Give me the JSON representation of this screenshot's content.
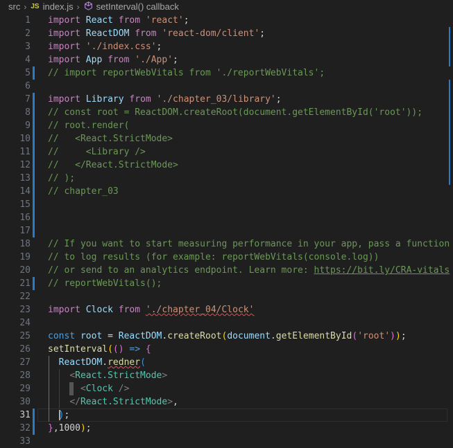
{
  "breadcrumb": {
    "folder": "src",
    "file_badge": "JS",
    "file": "index.js",
    "symbol": "setInterval() callback"
  },
  "editor": {
    "active_line": 31,
    "lines": [
      {
        "n": "1",
        "tokens": [
          [
            "kw",
            "import"
          ],
          [
            "pl",
            " "
          ],
          [
            "id",
            "React"
          ],
          [
            "pl",
            " "
          ],
          [
            "kw",
            "from"
          ],
          [
            "pl",
            " "
          ],
          [
            "st",
            "'react'"
          ],
          [
            "pl",
            ";"
          ]
        ]
      },
      {
        "n": "2",
        "tokens": [
          [
            "kw",
            "import"
          ],
          [
            "pl",
            " "
          ],
          [
            "id",
            "ReactDOM"
          ],
          [
            "pl",
            " "
          ],
          [
            "kw",
            "from"
          ],
          [
            "pl",
            " "
          ],
          [
            "st",
            "'react-dom/client'"
          ],
          [
            "pl",
            ";"
          ]
        ]
      },
      {
        "n": "3",
        "tokens": [
          [
            "kw",
            "import"
          ],
          [
            "pl",
            " "
          ],
          [
            "st",
            "'./index.css'"
          ],
          [
            "pl",
            ";"
          ]
        ]
      },
      {
        "n": "4",
        "tokens": [
          [
            "kw",
            "import"
          ],
          [
            "pl",
            " "
          ],
          [
            "id",
            "App"
          ],
          [
            "pl",
            " "
          ],
          [
            "kw",
            "from"
          ],
          [
            "pl",
            " "
          ],
          [
            "st",
            "'./App'"
          ],
          [
            "pl",
            ";"
          ]
        ]
      },
      {
        "n": "5",
        "tokens": [
          [
            "cm",
            "// import reportWebVitals from './reportWebVitals';"
          ]
        ]
      },
      {
        "n": "6",
        "tokens": []
      },
      {
        "n": "7",
        "tokens": [
          [
            "kw",
            "import"
          ],
          [
            "pl",
            " "
          ],
          [
            "id",
            "Library"
          ],
          [
            "pl",
            " "
          ],
          [
            "kw",
            "from"
          ],
          [
            "pl",
            " "
          ],
          [
            "st",
            "'./chapter_03/library'"
          ],
          [
            "pl",
            ";"
          ]
        ]
      },
      {
        "n": "8",
        "tokens": [
          [
            "cm",
            "// const root = ReactDOM.createRoot(document.getElementById('root'));"
          ]
        ]
      },
      {
        "n": "9",
        "tokens": [
          [
            "cm",
            "// root.render("
          ]
        ]
      },
      {
        "n": "10",
        "tokens": [
          [
            "cm",
            "//   <React.StrictMode>"
          ]
        ]
      },
      {
        "n": "11",
        "tokens": [
          [
            "cm",
            "//     <Library />"
          ]
        ]
      },
      {
        "n": "12",
        "tokens": [
          [
            "cm",
            "//   </React.StrictMode>"
          ]
        ]
      },
      {
        "n": "13",
        "tokens": [
          [
            "cm",
            "// );"
          ]
        ]
      },
      {
        "n": "14",
        "tokens": [
          [
            "cm",
            "// chapter_03"
          ]
        ]
      },
      {
        "n": "15",
        "tokens": []
      },
      {
        "n": "16",
        "tokens": []
      },
      {
        "n": "17",
        "tokens": []
      },
      {
        "n": "18",
        "tokens": [
          [
            "cm",
            "// If you want to start measuring performance in your app, pass a function"
          ]
        ]
      },
      {
        "n": "19",
        "tokens": [
          [
            "cm",
            "// to log results (for example: reportWebVitals(console.log))"
          ]
        ]
      },
      {
        "n": "20",
        "tokens": [
          [
            "cm",
            "// or send to an analytics endpoint. Learn more: "
          ],
          [
            "link",
            "https://bit.ly/CRA-vitals"
          ]
        ]
      },
      {
        "n": "21",
        "tokens": [
          [
            "cm",
            "// reportWebVitals();"
          ]
        ]
      },
      {
        "n": "22",
        "tokens": []
      },
      {
        "n": "23",
        "tokens": [
          [
            "kw",
            "import"
          ],
          [
            "pl",
            " "
          ],
          [
            "id",
            "Clock"
          ],
          [
            "pl",
            " "
          ],
          [
            "kw",
            "from"
          ],
          [
            "pl",
            " "
          ],
          [
            "st squig",
            "'./chapter_04/Clock'"
          ]
        ]
      },
      {
        "n": "24",
        "tokens": []
      },
      {
        "n": "25",
        "tokens": [
          [
            "bd",
            "const"
          ],
          [
            "pl",
            " "
          ],
          [
            "id",
            "root"
          ],
          [
            "pl",
            " = "
          ],
          [
            "id",
            "ReactDOM"
          ],
          [
            "pl",
            "."
          ],
          [
            "fn",
            "createRoot"
          ],
          [
            "b1",
            "("
          ],
          [
            "id",
            "document"
          ],
          [
            "pl",
            "."
          ],
          [
            "fn",
            "getElementById"
          ],
          [
            "b2",
            "("
          ],
          [
            "st",
            "'root'"
          ],
          [
            "b2",
            ")"
          ],
          [
            "b1",
            ")"
          ],
          [
            "pl",
            ";"
          ]
        ]
      },
      {
        "n": "26",
        "tokens": [
          [
            "fn",
            "setInterval"
          ],
          [
            "b1",
            "("
          ],
          [
            "b2",
            "()"
          ],
          [
            "pl",
            " "
          ],
          [
            "bd",
            "=>"
          ],
          [
            "pl",
            " "
          ],
          [
            "b2",
            "{"
          ]
        ]
      },
      {
        "n": "27",
        "tokens": [
          [
            "pl",
            "  "
          ],
          [
            "id",
            "ReactDOM"
          ],
          [
            "pl",
            "."
          ],
          [
            "fn squig",
            "redner"
          ],
          [
            "b3",
            "("
          ]
        ]
      },
      {
        "n": "28",
        "tokens": [
          [
            "pl",
            "    "
          ],
          [
            "tg",
            "<"
          ],
          [
            "jsx",
            "React.StrictMode"
          ],
          [
            "tg",
            ">"
          ]
        ]
      },
      {
        "n": "29",
        "tokens": [
          [
            "pl",
            "      "
          ],
          [
            "tg",
            "<"
          ],
          [
            "jsx",
            "Clock"
          ],
          [
            "pl",
            " "
          ],
          [
            "tg",
            "/>"
          ]
        ]
      },
      {
        "n": "30",
        "tokens": [
          [
            "pl",
            "    "
          ],
          [
            "tg",
            "</"
          ],
          [
            "jsx",
            "React.StrictMode"
          ],
          [
            "tg",
            ">"
          ],
          [
            "pl",
            ","
          ]
        ]
      },
      {
        "n": "31",
        "tokens": [
          [
            "pl",
            "  "
          ],
          [
            "b3",
            ")"
          ],
          [
            "pl",
            ";"
          ]
        ]
      },
      {
        "n": "32",
        "tokens": [
          [
            "b2",
            "}"
          ],
          [
            "pl",
            ","
          ],
          [
            "pl",
            "1000"
          ],
          [
            "b1",
            ")"
          ],
          [
            "pl",
            ";"
          ]
        ]
      },
      {
        "n": "33",
        "tokens": []
      }
    ],
    "modified_lines": [
      "5",
      "7",
      "8",
      "9",
      "10",
      "11",
      "12",
      "13",
      "14",
      "15",
      "16",
      "17",
      "21",
      "31",
      "32"
    ]
  }
}
